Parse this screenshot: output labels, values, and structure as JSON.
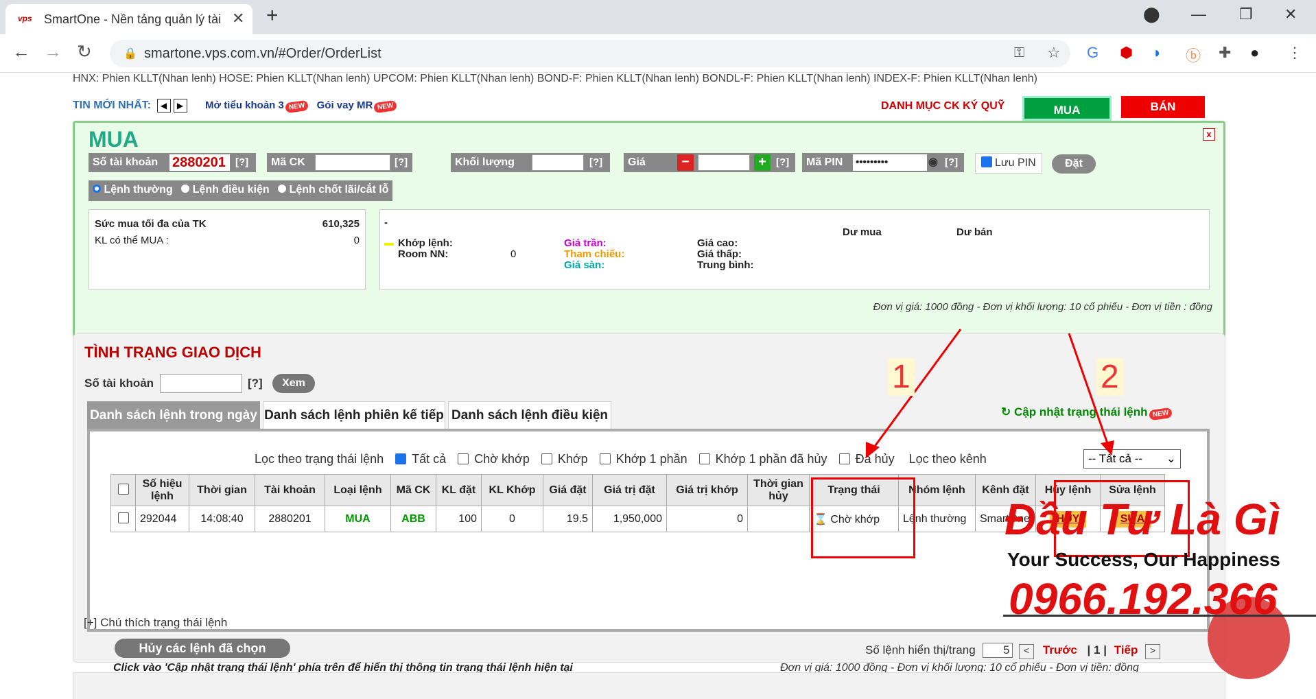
{
  "browser": {
    "tab_title": "SmartOne - Nền tảng quản lý tài",
    "favicon": "vps",
    "url": "smartone.vps.com.vn/#Order/OrderList"
  },
  "marquee": "HNX: Phien KLLT(Nhan lenh)  HOSE: Phien KLLT(Nhan lenh)  UPCOM: Phien KLLT(Nhan lenh)  BOND-F: Phien KLLT(Nhan lenh)  BONDL-F: Phien KLLT(Nhan lenh)  INDEX-F: Phien KLLT(Nhan lenh)",
  "news": {
    "label": "TIN MỚI NHẤT:",
    "item1": "Mở tiểu khoản 3",
    "item2": "Gói vay MR",
    "badge": "NEW"
  },
  "top_tabs": {
    "danhmuc": "DANH MỤC CK KÝ QUỸ",
    "mua": "MUA",
    "ban": "BÁN"
  },
  "mua_form": {
    "title": "MUA",
    "close": "x",
    "so_tai_khoan_label": "Số tài khoản",
    "so_tai_khoan": "2880201",
    "help": "[?]",
    "ma_ck_label": "Mã CK",
    "khoi_luong_label": "Khối lượng",
    "gia_label": "Giá",
    "ma_pin_label": "Mã PIN",
    "ma_pin_value": "•••••••••",
    "luu_pin": "Lưu PIN",
    "dat": "Đặt",
    "order_types": [
      "Lệnh thường",
      "Lệnh điều kiện",
      "Lệnh chốt lãi/cắt lỗ"
    ],
    "suc_mua_label": "Sức mua tối đa của TK",
    "suc_mua_value": "610,325",
    "kl_label": "KL có thể MUA :",
    "kl_value": "0",
    "dash": "-",
    "khop_lenh": "Khớp lệnh:",
    "room_nn": "Room NN:",
    "room_nn_value": "0",
    "gia_tran": "Giá trần:",
    "tham_chieu": "Tham chiếu:",
    "gia_san": "Giá sàn:",
    "gia_cao": "Giá cao:",
    "gia_thap": "Giá thấp:",
    "trung_binh": "Trung bình:",
    "du_mua": "Dư mua",
    "du_ban": "Dư bán",
    "unit_note": "Đơn vị giá: 1000 đồng - Đơn vị khối lượng: 10 cổ phiếu - Đơn vị tiền : đồng"
  },
  "status_panel": {
    "title": "TÌNH TRẠNG GIAO DỊCH",
    "so_tai_khoan_label": "Số tài khoản",
    "help": "[?]",
    "xem": "Xem",
    "tabs": [
      "Danh sách lệnh trong ngày",
      "Danh sách lệnh phiên kế tiếp",
      "Danh sách lệnh điều kiện"
    ],
    "cap_nhat": "Cập nhật trạng thái lệnh",
    "filter_label": "Lọc theo trạng thái lệnh",
    "filters": [
      "Tất cả",
      "Chờ khớp",
      "Khớp",
      "Khớp 1 phần",
      "Khớp 1 phần đã hủy",
      "Đã hủy"
    ],
    "kenh_label": "Lọc theo kênh",
    "kenh_value": "-- Tất cả --",
    "columns": [
      "Số hiệu lệnh",
      "Thời gian",
      "Tài khoản",
      "Loại lệnh",
      "Mã CK",
      "KL đặt",
      "KL Khớp",
      "Giá đặt",
      "Giá trị đặt",
      "Giá trị khớp",
      "Thời gian hủy",
      "Trạng thái",
      "Nhóm lệnh",
      "Kênh đặt",
      "Hủy lệnh",
      "Sửa lệnh"
    ],
    "row": {
      "so_hieu": "292044",
      "thoi_gian": "14:08:40",
      "tai_khoan": "2880201",
      "loai_lenh": "MUA",
      "ma_ck": "ABB",
      "kl_dat": "100",
      "kl_khop": "0",
      "gia_dat": "19.5",
      "gia_tri_dat": "1,950,000",
      "gia_tri_khop": "0",
      "thoi_gian_huy": "",
      "trang_thai": "Chờ khớp",
      "nhom_lenh": "Lệnh thường",
      "kenh_dat": "SmartOne",
      "huy": "HỦY",
      "sua": "SỬA"
    },
    "huy_chon": "Hủy các lệnh đã chọn",
    "so_lenh_label": "Số lệnh hiển thị/trang",
    "so_lenh_value": "5",
    "prev": "Trước",
    "page": "1",
    "next": "Tiếp",
    "next_arrow": ">",
    "prev_arrow": "<",
    "click_note": "Click vào 'Cập nhật trạng thái lệnh' phía trên để hiển thị thông tin trạng thái lệnh hiện tại",
    "unit_note": "Đơn vị giá: 1000 đồng - Đơn vị khối lượng: 10 cổ phiếu - Đơn vị tiền: đồng",
    "chu_thich": "[+] Chú thích trạng thái lệnh"
  },
  "annotations": {
    "n1": "1",
    "n2": "2"
  },
  "watermark": {
    "title": "Đầu Tư Là Gì",
    "slogan": "Your Success, Our Happiness",
    "phone": "0966.192.366"
  },
  "colors": {
    "accent_red": "#cc0000",
    "buy_green": "#00a040",
    "panel_green": "#e8fce8"
  }
}
